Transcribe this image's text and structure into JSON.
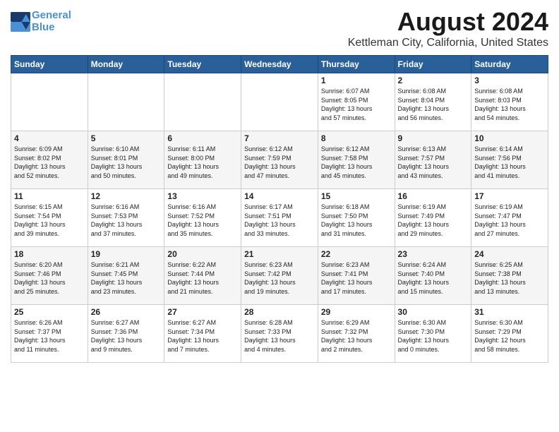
{
  "logo": {
    "line1": "General",
    "line2": "Blue"
  },
  "title": "August 2024",
  "subtitle": "Kettleman City, California, United States",
  "days_header": [
    "Sunday",
    "Monday",
    "Tuesday",
    "Wednesday",
    "Thursday",
    "Friday",
    "Saturday"
  ],
  "weeks": [
    [
      {
        "day": "",
        "info": ""
      },
      {
        "day": "",
        "info": ""
      },
      {
        "day": "",
        "info": ""
      },
      {
        "day": "",
        "info": ""
      },
      {
        "day": "1",
        "info": "Sunrise: 6:07 AM\nSunset: 8:05 PM\nDaylight: 13 hours\nand 57 minutes."
      },
      {
        "day": "2",
        "info": "Sunrise: 6:08 AM\nSunset: 8:04 PM\nDaylight: 13 hours\nand 56 minutes."
      },
      {
        "day": "3",
        "info": "Sunrise: 6:08 AM\nSunset: 8:03 PM\nDaylight: 13 hours\nand 54 minutes."
      }
    ],
    [
      {
        "day": "4",
        "info": "Sunrise: 6:09 AM\nSunset: 8:02 PM\nDaylight: 13 hours\nand 52 minutes."
      },
      {
        "day": "5",
        "info": "Sunrise: 6:10 AM\nSunset: 8:01 PM\nDaylight: 13 hours\nand 50 minutes."
      },
      {
        "day": "6",
        "info": "Sunrise: 6:11 AM\nSunset: 8:00 PM\nDaylight: 13 hours\nand 49 minutes."
      },
      {
        "day": "7",
        "info": "Sunrise: 6:12 AM\nSunset: 7:59 PM\nDaylight: 13 hours\nand 47 minutes."
      },
      {
        "day": "8",
        "info": "Sunrise: 6:12 AM\nSunset: 7:58 PM\nDaylight: 13 hours\nand 45 minutes."
      },
      {
        "day": "9",
        "info": "Sunrise: 6:13 AM\nSunset: 7:57 PM\nDaylight: 13 hours\nand 43 minutes."
      },
      {
        "day": "10",
        "info": "Sunrise: 6:14 AM\nSunset: 7:56 PM\nDaylight: 13 hours\nand 41 minutes."
      }
    ],
    [
      {
        "day": "11",
        "info": "Sunrise: 6:15 AM\nSunset: 7:54 PM\nDaylight: 13 hours\nand 39 minutes."
      },
      {
        "day": "12",
        "info": "Sunrise: 6:16 AM\nSunset: 7:53 PM\nDaylight: 13 hours\nand 37 minutes."
      },
      {
        "day": "13",
        "info": "Sunrise: 6:16 AM\nSunset: 7:52 PM\nDaylight: 13 hours\nand 35 minutes."
      },
      {
        "day": "14",
        "info": "Sunrise: 6:17 AM\nSunset: 7:51 PM\nDaylight: 13 hours\nand 33 minutes."
      },
      {
        "day": "15",
        "info": "Sunrise: 6:18 AM\nSunset: 7:50 PM\nDaylight: 13 hours\nand 31 minutes."
      },
      {
        "day": "16",
        "info": "Sunrise: 6:19 AM\nSunset: 7:49 PM\nDaylight: 13 hours\nand 29 minutes."
      },
      {
        "day": "17",
        "info": "Sunrise: 6:19 AM\nSunset: 7:47 PM\nDaylight: 13 hours\nand 27 minutes."
      }
    ],
    [
      {
        "day": "18",
        "info": "Sunrise: 6:20 AM\nSunset: 7:46 PM\nDaylight: 13 hours\nand 25 minutes."
      },
      {
        "day": "19",
        "info": "Sunrise: 6:21 AM\nSunset: 7:45 PM\nDaylight: 13 hours\nand 23 minutes."
      },
      {
        "day": "20",
        "info": "Sunrise: 6:22 AM\nSunset: 7:44 PM\nDaylight: 13 hours\nand 21 minutes."
      },
      {
        "day": "21",
        "info": "Sunrise: 6:23 AM\nSunset: 7:42 PM\nDaylight: 13 hours\nand 19 minutes."
      },
      {
        "day": "22",
        "info": "Sunrise: 6:23 AM\nSunset: 7:41 PM\nDaylight: 13 hours\nand 17 minutes."
      },
      {
        "day": "23",
        "info": "Sunrise: 6:24 AM\nSunset: 7:40 PM\nDaylight: 13 hours\nand 15 minutes."
      },
      {
        "day": "24",
        "info": "Sunrise: 6:25 AM\nSunset: 7:38 PM\nDaylight: 13 hours\nand 13 minutes."
      }
    ],
    [
      {
        "day": "25",
        "info": "Sunrise: 6:26 AM\nSunset: 7:37 PM\nDaylight: 13 hours\nand 11 minutes."
      },
      {
        "day": "26",
        "info": "Sunrise: 6:27 AM\nSunset: 7:36 PM\nDaylight: 13 hours\nand 9 minutes."
      },
      {
        "day": "27",
        "info": "Sunrise: 6:27 AM\nSunset: 7:34 PM\nDaylight: 13 hours\nand 7 minutes."
      },
      {
        "day": "28",
        "info": "Sunrise: 6:28 AM\nSunset: 7:33 PM\nDaylight: 13 hours\nand 4 minutes."
      },
      {
        "day": "29",
        "info": "Sunrise: 6:29 AM\nSunset: 7:32 PM\nDaylight: 13 hours\nand 2 minutes."
      },
      {
        "day": "30",
        "info": "Sunrise: 6:30 AM\nSunset: 7:30 PM\nDaylight: 13 hours\nand 0 minutes."
      },
      {
        "day": "31",
        "info": "Sunrise: 6:30 AM\nSunset: 7:29 PM\nDaylight: 12 hours\nand 58 minutes."
      }
    ]
  ]
}
